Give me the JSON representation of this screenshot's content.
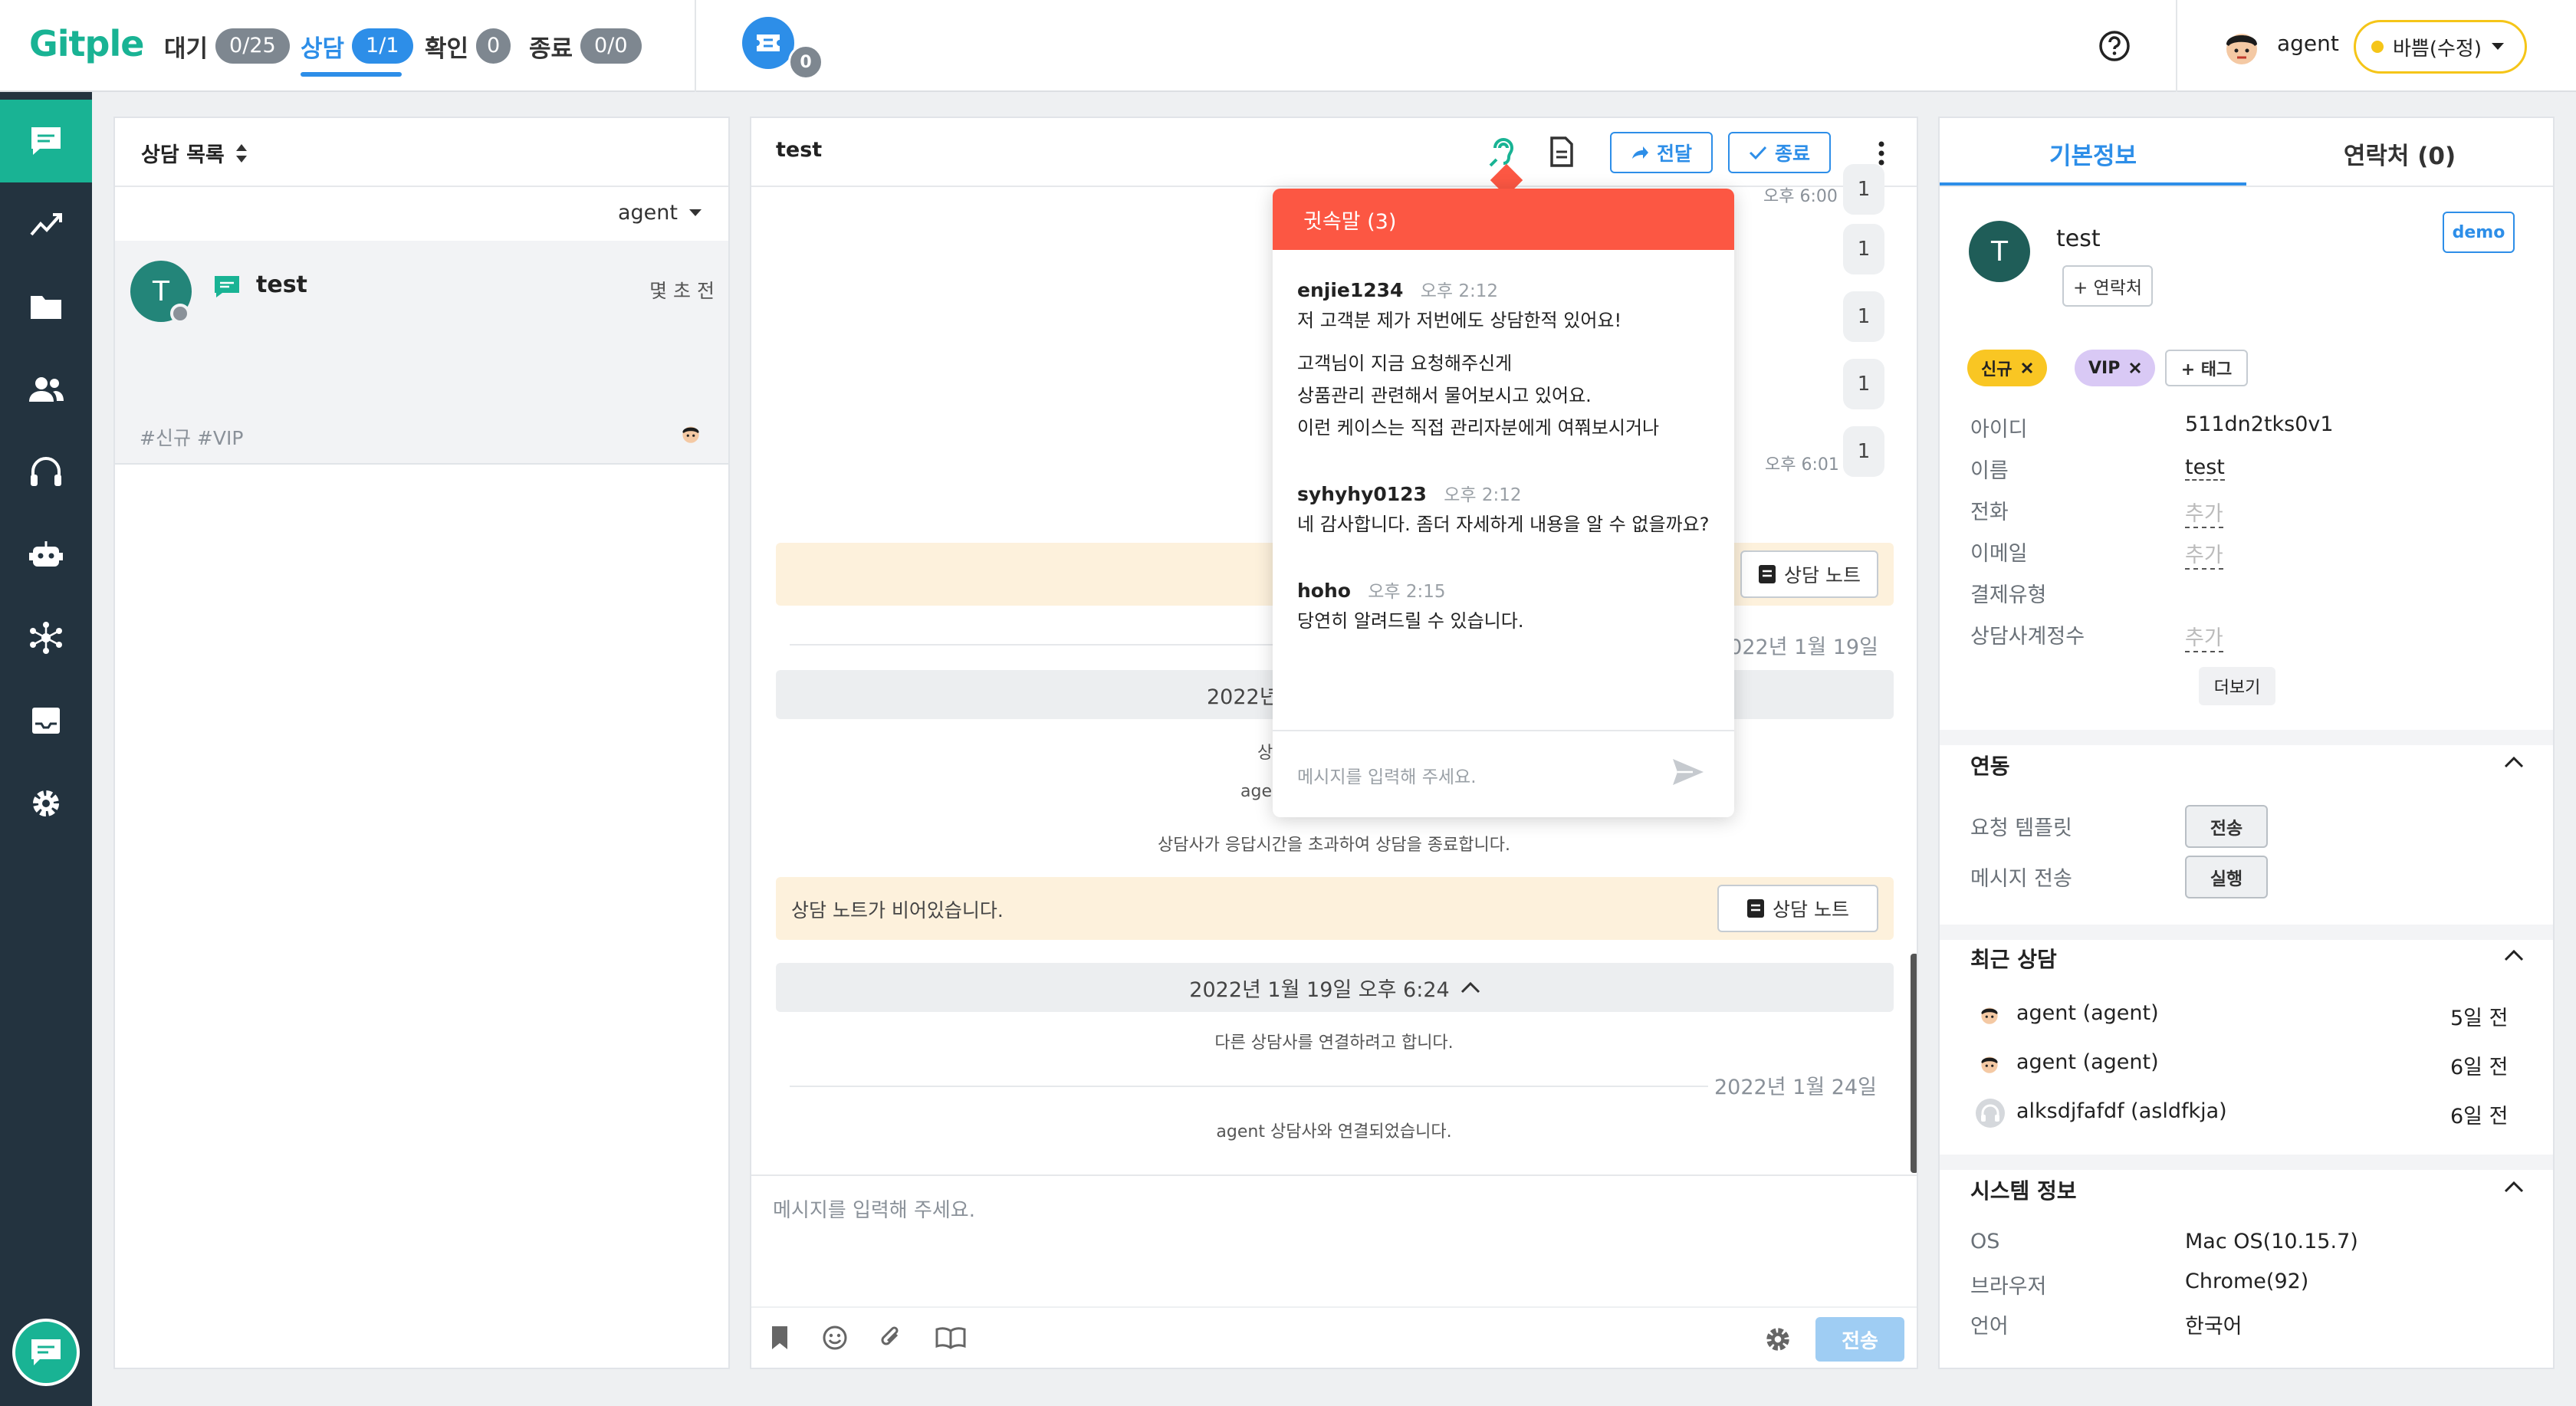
{
  "app": {
    "logo": "Gitple"
  },
  "status_tabs": [
    {
      "label": "대기",
      "count": "0/25"
    },
    {
      "label": "상담",
      "count": "1/1"
    },
    {
      "label": "확인",
      "count": "0"
    },
    {
      "label": "종료",
      "count": "0/0"
    }
  ],
  "ticket_badge": "0",
  "header_right": {
    "help_icon": "help-circle-icon",
    "agent_name": "agent",
    "status_label": "바쁨(수정)",
    "status_color": "#f5c518"
  },
  "sidebar": {
    "items": [
      "chat-icon",
      "analytics-icon",
      "folder-icon",
      "users-icon",
      "headset-icon",
      "bot-icon",
      "network-icon",
      "inbox-icon",
      "settings-icon"
    ]
  },
  "list_panel": {
    "title": "상담 목록",
    "filter": "agent",
    "items": [
      {
        "avatar": "T",
        "name": "test",
        "time": "몇 초 전",
        "tags": "#신규 #VIP"
      }
    ]
  },
  "chat": {
    "title": "test",
    "forward_label": "전달",
    "end_label": "종료",
    "times": [
      "오후 6:00",
      "오후 6:01"
    ],
    "counts": [
      "1",
      "1",
      "1",
      "1"
    ],
    "note_label": "상담 노트",
    "date_label_1": "2022년 1월 19일",
    "datebar_1_partial": "2022년",
    "sys_partial_1": "상담",
    "sys_partial_2": "agen",
    "sys_timeout": "상담사가 응답시간을 초과하여 상담을 종료합니다.",
    "note_empty": "상담 노트가 비어있습니다.",
    "datebar_2": "2022년 1월 19일 오후 6:24",
    "sys_transfer": "다른 상담사를 연결하려고 합니다.",
    "date_label_2": "2022년 1월 24일",
    "sys_connected": "agent 상담사와 연결되었습니다.",
    "input_placeholder": "메시지를 입력해 주세요.",
    "send_label": "전송"
  },
  "whisper": {
    "title": "귓속말 (3)",
    "messages": [
      {
        "user": "enjie1234",
        "time": "오후 2:12",
        "lines": [
          "저 고객분 제가 저번에도 상담한적 있어요!"
        ],
        "lines2": [
          "고객님이 지금 요청해주신게",
          "상품관리 관련해서 물어보시고 있어요.",
          "이런 케이스는 직접 관리자분에게 여쭤보시거나"
        ]
      },
      {
        "user": "syhyhy0123",
        "time": "오후 2:12",
        "lines": [
          "네 감사합니다. 좀더 자세하게 내용을 알 수 없을까요?"
        ]
      },
      {
        "user": "hoho",
        "time": "오후 2:15",
        "lines": [
          "당연히 알려드릴 수 있습니다."
        ]
      }
    ],
    "input_placeholder": "메시지를 입력해 주세요."
  },
  "info": {
    "tabs": [
      "기본정보",
      "연락처 (0)"
    ],
    "avatar": "T",
    "name": "test",
    "add_contact": "+ 연락처",
    "demo_label": "demo",
    "tags": [
      {
        "label": "신규",
        "color": "#f9c623"
      },
      {
        "label": "VIP",
        "color": "#d9c9f5"
      }
    ],
    "add_tag": "+ 태그",
    "fields": [
      {
        "label": "아이디",
        "value": "511dn2tks0v1"
      },
      {
        "label": "이름",
        "value": "test"
      },
      {
        "label": "전화",
        "value": "추가"
      },
      {
        "label": "이메일",
        "value": "추가"
      },
      {
        "label": "결제유형",
        "value": ""
      },
      {
        "label": "상담사계정수",
        "value": "추가"
      }
    ],
    "more_label": "더보기",
    "integration": {
      "title": "연동",
      "rows": [
        {
          "label": "요청 템플릿",
          "button": "전송"
        },
        {
          "label": "메시지 전송",
          "button": "실행"
        }
      ]
    },
    "recent": {
      "title": "최근 상담",
      "rows": [
        {
          "name": "agent (agent)",
          "ago": "5일 전"
        },
        {
          "name": "agent (agent)",
          "ago": "6일 전"
        },
        {
          "name": "alksdjfafdf (asldfkja)",
          "ago": "6일 전"
        }
      ]
    },
    "system": {
      "title": "시스템 정보",
      "rows": [
        {
          "label": "OS",
          "value": "Mac OS(10.15.7)"
        },
        {
          "label": "브라우저",
          "value": "Chrome(92)"
        },
        {
          "label": "언어",
          "value": "한국어"
        }
      ]
    }
  }
}
